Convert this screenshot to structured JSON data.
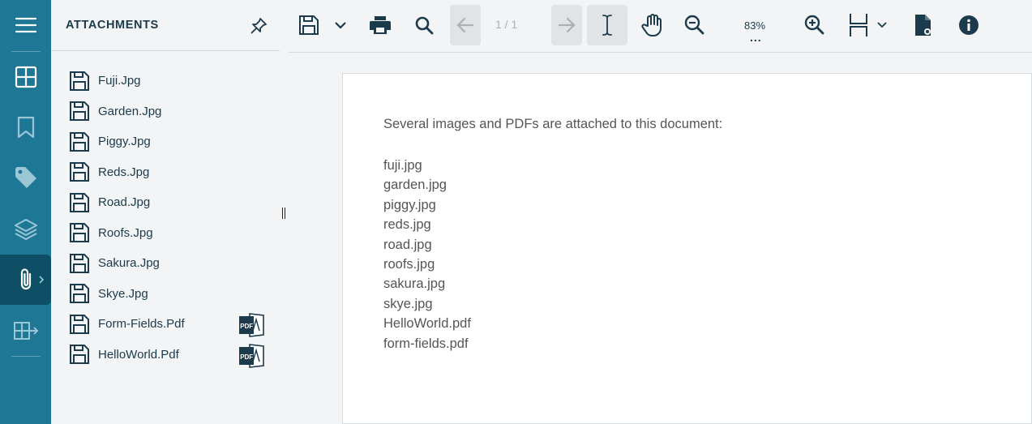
{
  "panel": {
    "title": "ATTACHMENTS",
    "attachments": [
      {
        "name": "Fuji.Jpg",
        "is_pdf": false
      },
      {
        "name": "Garden.Jpg",
        "is_pdf": false
      },
      {
        "name": "Piggy.Jpg",
        "is_pdf": false
      },
      {
        "name": "Reds.Jpg",
        "is_pdf": false
      },
      {
        "name": "Road.Jpg",
        "is_pdf": false
      },
      {
        "name": "Roofs.Jpg",
        "is_pdf": false
      },
      {
        "name": "Sakura.Jpg",
        "is_pdf": false
      },
      {
        "name": "Skye.Jpg",
        "is_pdf": false
      },
      {
        "name": "Form-Fields.Pdf",
        "is_pdf": true,
        "badge": "PDF"
      },
      {
        "name": "HelloWorld.Pdf",
        "is_pdf": true,
        "badge": "PDF"
      }
    ]
  },
  "rail": {
    "items": [
      "menu-icon",
      "thumbnails-icon",
      "bookmark-icon",
      "tag-icon",
      "layers-icon",
      "attachment-icon",
      "export-icon"
    ],
    "active": "attachment-icon"
  },
  "toolbar": {
    "page_indicator": "1 / 1",
    "zoom": "83%",
    "zoom_more": "..."
  },
  "document": {
    "intro": "Several images and PDFs are attached to this document:",
    "lines": [
      "fuji.jpg",
      "garden.jpg",
      "piggy.jpg",
      "reds.jpg",
      "road.jpg",
      "roofs.jpg",
      "sakura.jpg",
      "skye.jpg",
      "HelloWorld.pdf",
      "form-fields.pdf"
    ]
  },
  "colors": {
    "rail_bg": "#1d7795",
    "rail_active": "#0e4f66",
    "icon_dark": "#1b3a4b",
    "panel_bg": "#f2f4f5"
  }
}
